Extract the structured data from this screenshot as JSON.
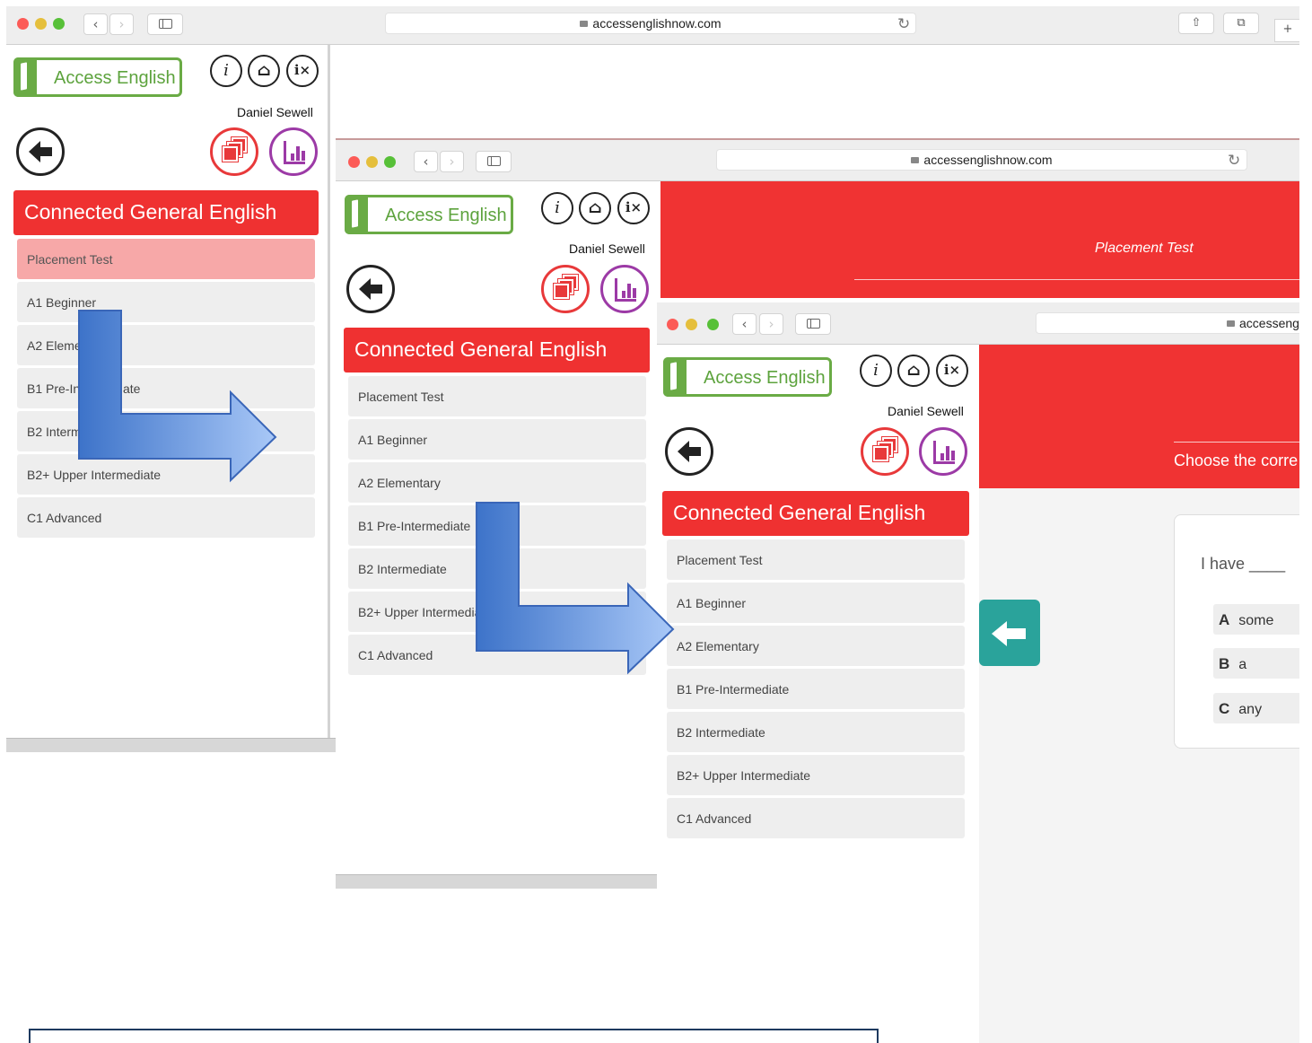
{
  "browser": {
    "url": "accessenglishnow.com",
    "url_cropped": "accesseng"
  },
  "app": {
    "logo_text": "Access English",
    "user_name": "Daniel Sewell",
    "course_title": "Connected General English",
    "levels": [
      "Placement Test",
      "A1 Beginner",
      "A2 Elementary",
      "B1 Pre-Intermediate",
      "B2 Intermediate",
      "B2+ Upper Intermediate",
      "C1 Advanced"
    ]
  },
  "window1": {
    "levels_visible": [
      "Placement Test",
      "A1 Beginner",
      "A2 Eleme",
      "B1 Pre-In",
      "B2 Interm",
      "B2+ Upper Intermediate",
      "C1 Advanced"
    ],
    "b1_fragment": "ate"
  },
  "window2": {
    "panel_title": "Placement Test",
    "b2plus_cropped": "B2+ Upper Intermedia"
  },
  "window3": {
    "instruction": "Choose the corre",
    "question": "I have ____",
    "options": [
      {
        "letter": "A",
        "text": "some"
      },
      {
        "letter": "B",
        "text": "a"
      },
      {
        "letter": "C",
        "text": "any"
      }
    ]
  },
  "colors": {
    "brand_green": "#6aab45",
    "brand_red": "#ef3131",
    "purple": "#9c3aa6",
    "teal": "#2aa39b",
    "arrow_blue": "#4a7fd1"
  },
  "icons": [
    "info-icon",
    "home-icon",
    "accessibility-icon",
    "back-arrow-icon",
    "stacked-cards-icon",
    "stats-chart-icon",
    "sidebar-icon",
    "share-icon",
    "tabs-icon",
    "plus-icon",
    "reload-icon",
    "lock-icon"
  ]
}
